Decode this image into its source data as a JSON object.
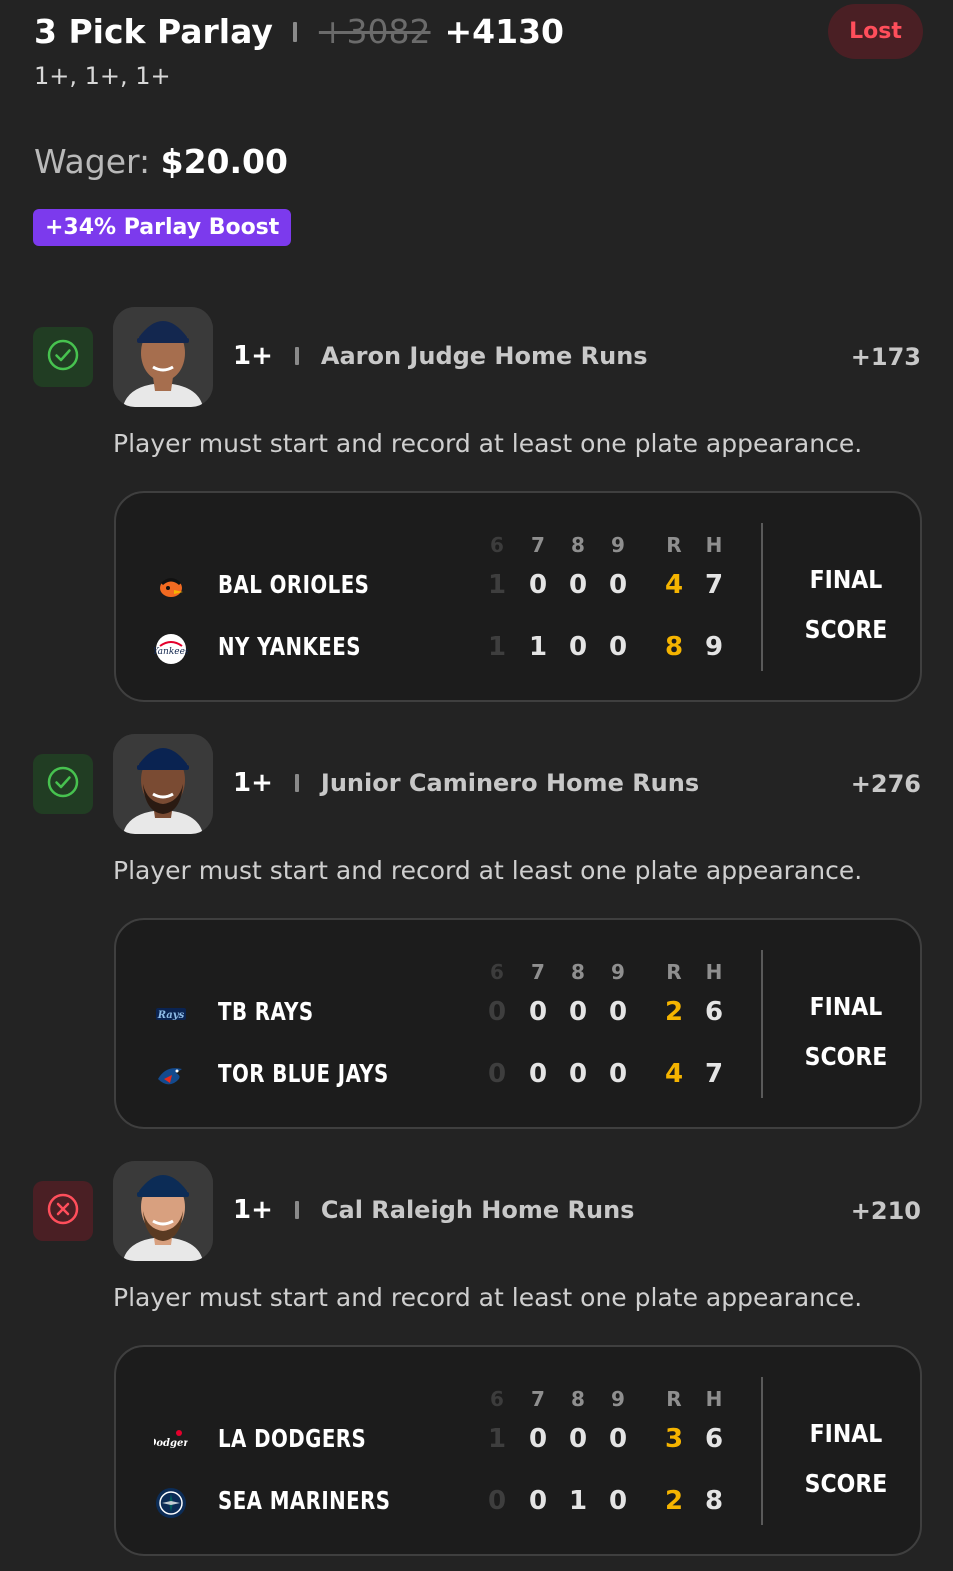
{
  "header": {
    "title": "3 Pick Parlay",
    "old_odds": "+3082",
    "odds": "+4130",
    "selections": "1+, 1+, 1+",
    "status": "Lost"
  },
  "wager": {
    "label": "Wager:",
    "amount": "$20.00"
  },
  "boost": "+34% Parlay Boost",
  "colors": {
    "win": "#47c24f",
    "loss": "#ff4e5b",
    "boost": "#7c3aed",
    "runs": "#f5b400"
  },
  "score_headers": [
    "6",
    "7",
    "8",
    "9",
    "R",
    "H"
  ],
  "legs": [
    {
      "result": "won",
      "status_icon": "check-circle-icon",
      "line": "1+",
      "market": "Aaron Judge Home Runs",
      "odds": "+173",
      "rule": "Player must start and record at least one plate appearance.",
      "final": [
        "FINAL",
        "SCORE"
      ],
      "teams": [
        {
          "name": "BAL ORIOLES",
          "logo": "orioles-logo-icon",
          "cells": [
            "1",
            "0",
            "0",
            "0",
            "4",
            "7"
          ]
        },
        {
          "name": "NY YANKEES",
          "logo": "yankees-logo-icon",
          "cells": [
            "1",
            "1",
            "0",
            "0",
            "8",
            "9"
          ]
        }
      ]
    },
    {
      "result": "won",
      "status_icon": "check-circle-icon",
      "line": "1+",
      "market": "Junior Caminero Home Runs",
      "odds": "+276",
      "rule": "Player must start and record at least one plate appearance.",
      "final": [
        "FINAL",
        "SCORE"
      ],
      "teams": [
        {
          "name": "TB RAYS",
          "logo": "rays-logo-icon",
          "cells": [
            "0",
            "0",
            "0",
            "0",
            "2",
            "6"
          ]
        },
        {
          "name": "TOR BLUE JAYS",
          "logo": "blue-jays-logo-icon",
          "cells": [
            "0",
            "0",
            "0",
            "0",
            "4",
            "7"
          ]
        }
      ]
    },
    {
      "result": "lost",
      "status_icon": "x-circle-icon",
      "line": "1+",
      "market": "Cal Raleigh Home Runs",
      "odds": "+210",
      "rule": "Player must start and record at least one plate appearance.",
      "final": [
        "FINAL",
        "SCORE"
      ],
      "teams": [
        {
          "name": "LA DODGERS",
          "logo": "dodgers-logo-icon",
          "cells": [
            "1",
            "0",
            "0",
            "0",
            "3",
            "6"
          ]
        },
        {
          "name": "SEA MARINERS",
          "logo": "mariners-logo-icon",
          "cells": [
            "0",
            "0",
            "1",
            "0",
            "2",
            "8"
          ]
        }
      ]
    }
  ]
}
